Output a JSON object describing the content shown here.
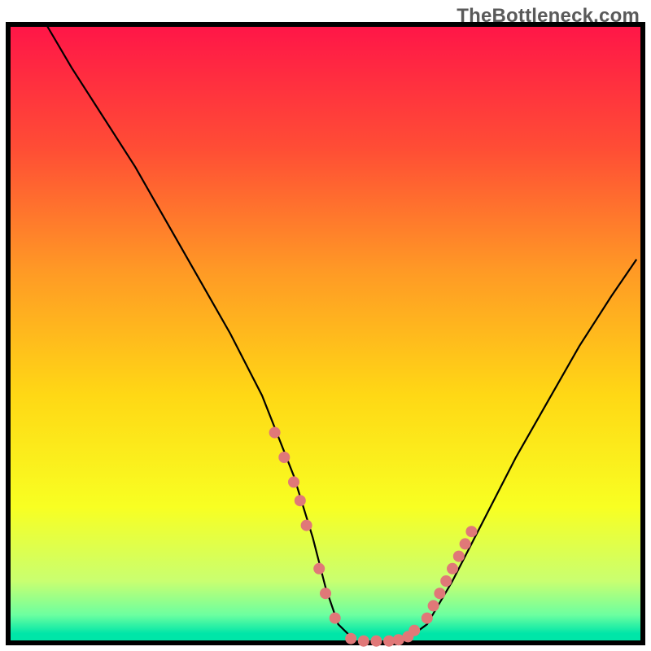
{
  "watermark": "TheBottleneck.com",
  "chart_data": {
    "type": "line",
    "title": "",
    "xlabel": "",
    "ylabel": "",
    "xlim": [
      0,
      100
    ],
    "ylim": [
      0,
      100
    ],
    "grid": false,
    "legend": false,
    "background_gradient_stops": [
      {
        "offset": 0.0,
        "color": "#ff1548"
      },
      {
        "offset": 0.2,
        "color": "#ff4d35"
      },
      {
        "offset": 0.4,
        "color": "#ff9a25"
      },
      {
        "offset": 0.6,
        "color": "#ffd815"
      },
      {
        "offset": 0.78,
        "color": "#f8ff22"
      },
      {
        "offset": 0.9,
        "color": "#c9ff70"
      },
      {
        "offset": 0.955,
        "color": "#6cffa0"
      },
      {
        "offset": 0.985,
        "color": "#00e6a8"
      },
      {
        "offset": 1.0,
        "color": "#00e6a8"
      }
    ],
    "series": [
      {
        "name": "bottleneck-curve",
        "color": "#000000",
        "x": [
          6,
          10,
          15,
          20,
          25,
          30,
          35,
          40,
          45,
          48,
          50,
          52,
          55,
          58,
          62,
          66,
          70,
          75,
          80,
          85,
          90,
          95,
          99
        ],
        "values": [
          100,
          93,
          85,
          77,
          68,
          59,
          50,
          40,
          27,
          17,
          9,
          3,
          0,
          0,
          0,
          3,
          10,
          20,
          30,
          39,
          48,
          56,
          62
        ]
      }
    ],
    "markers": {
      "name": "highlight-dots",
      "color": "#e07878",
      "radius_px": 7,
      "points": [
        {
          "x": 42,
          "y": 34
        },
        {
          "x": 43.5,
          "y": 30
        },
        {
          "x": 45,
          "y": 26
        },
        {
          "x": 46,
          "y": 23
        },
        {
          "x": 47,
          "y": 19
        },
        {
          "x": 49,
          "y": 12
        },
        {
          "x": 50,
          "y": 8
        },
        {
          "x": 51.5,
          "y": 4
        },
        {
          "x": 54,
          "y": 0.7
        },
        {
          "x": 56,
          "y": 0.3
        },
        {
          "x": 58,
          "y": 0.3
        },
        {
          "x": 60,
          "y": 0.3
        },
        {
          "x": 61.5,
          "y": 0.5
        },
        {
          "x": 63,
          "y": 1
        },
        {
          "x": 64,
          "y": 2
        },
        {
          "x": 66,
          "y": 4
        },
        {
          "x": 67,
          "y": 6
        },
        {
          "x": 68,
          "y": 8
        },
        {
          "x": 69,
          "y": 10
        },
        {
          "x": 70,
          "y": 12
        },
        {
          "x": 71,
          "y": 14
        },
        {
          "x": 72,
          "y": 16
        },
        {
          "x": 73,
          "y": 18
        }
      ]
    }
  }
}
